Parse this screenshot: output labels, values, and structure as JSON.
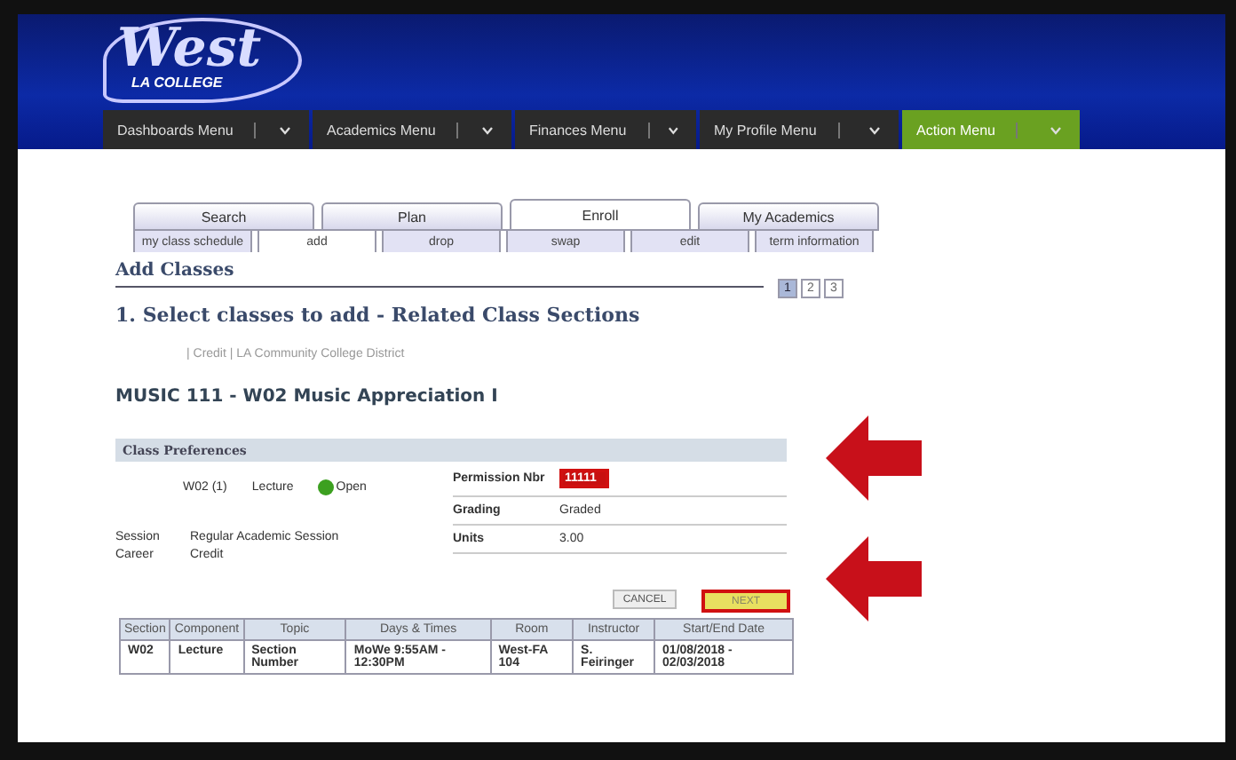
{
  "logo": {
    "name": "West",
    "tagline": "LA COLLEGE"
  },
  "menus": [
    {
      "label": "Dashboards Menu",
      "active": false
    },
    {
      "label": "Academics Menu",
      "active": false
    },
    {
      "label": "Finances Menu",
      "active": false
    },
    {
      "label": "My Profile Menu",
      "active": false
    },
    {
      "label": "Action Menu",
      "active": true
    }
  ],
  "tabs": [
    {
      "label": "Search",
      "selected": false
    },
    {
      "label": "Plan",
      "selected": false
    },
    {
      "label": "Enroll",
      "selected": true
    },
    {
      "label": "My Academics",
      "selected": false
    }
  ],
  "subtabs": [
    {
      "label": "my class schedule",
      "selected": false
    },
    {
      "label": "add",
      "selected": true
    },
    {
      "label": "drop",
      "selected": false
    },
    {
      "label": "swap",
      "selected": false
    },
    {
      "label": "edit",
      "selected": false
    },
    {
      "label": "term information",
      "selected": false
    }
  ],
  "page_title": "Add Classes",
  "steps": [
    {
      "label": "1",
      "selected": true
    },
    {
      "label": "2",
      "selected": false
    },
    {
      "label": "3",
      "selected": false
    }
  ],
  "step_heading": "1.  Select classes to add - Related Class Sections",
  "term_line": "| Credit | LA Community College District",
  "course_title": "MUSIC 111 - W02   Music Appreciation I",
  "preferences": {
    "title": "Class Preferences",
    "section": "W02 (1)",
    "component": "Lecture",
    "status": "Open",
    "fields": [
      {
        "label": "Permission Nbr",
        "value": "11111",
        "kind": "input"
      },
      {
        "label": "Grading",
        "value": "Graded",
        "kind": "text"
      },
      {
        "label": "Units",
        "value": "3.00",
        "kind": "text"
      }
    ],
    "info": [
      {
        "label": "Session",
        "value": "Regular Academic Session"
      },
      {
        "label": "Career",
        "value": "Credit"
      }
    ]
  },
  "buttons": [
    {
      "label": "CANCEL",
      "highlighted": false
    },
    {
      "label": "NEXT",
      "highlighted": true
    }
  ],
  "table": {
    "columns": [
      "Section",
      "Component",
      "Topic",
      "Days & Times",
      "Room",
      "Instructor",
      "Start/End Date"
    ],
    "rows": [
      [
        "W02",
        "Lecture",
        "Section Number",
        "MoWe 9:55AM - 12:30PM",
        "West-FA 104",
        "S. Feiringer",
        "01/08/2018 - 02/03/2018"
      ]
    ]
  }
}
